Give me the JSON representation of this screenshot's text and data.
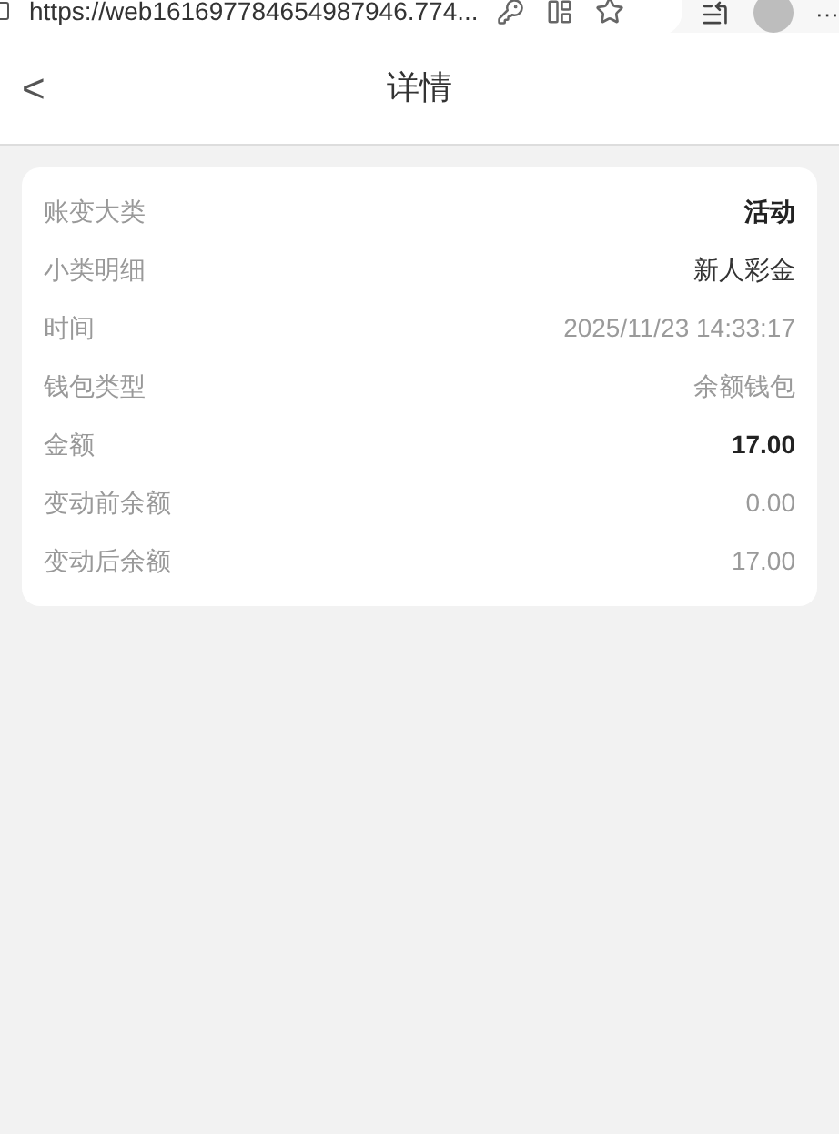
{
  "browser": {
    "url": "https://web161697784654987946.774...",
    "menu": "···"
  },
  "header": {
    "back": "<",
    "title": "详情"
  },
  "details": [
    {
      "label": "账变大类",
      "value": "活动",
      "kind": "bold"
    },
    {
      "label": "小类明细",
      "value": "新人彩金",
      "kind": "dark"
    },
    {
      "label": "时间",
      "value": "2025/11/23 14:33:17",
      "kind": "muted"
    },
    {
      "label": "钱包类型",
      "value": "余额钱包",
      "kind": "muted"
    },
    {
      "label": "金额",
      "value": "17.00",
      "kind": "bold"
    },
    {
      "label": "变动前余额",
      "value": "0.00",
      "kind": "muted"
    },
    {
      "label": "变动后余额",
      "value": "17.00",
      "kind": "muted"
    }
  ]
}
